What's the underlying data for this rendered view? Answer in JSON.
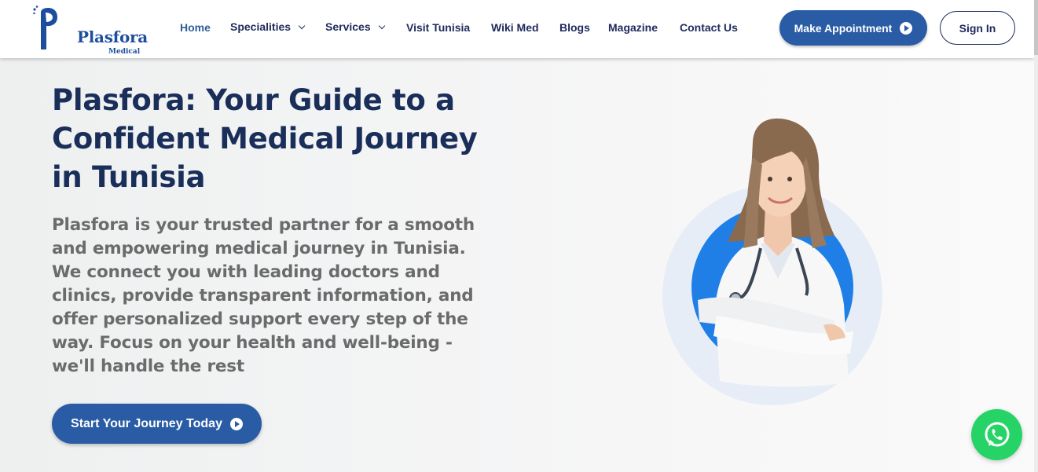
{
  "brand": {
    "name": "Plasfora",
    "sub": "Medical"
  },
  "nav": {
    "home": "Home",
    "specialities": "Specialities",
    "services": "Services",
    "visit": "Visit Tunisia",
    "wiki": "Wiki Med",
    "blogs": "Blogs",
    "magazine": "Magazine",
    "contact": "Contact Us"
  },
  "actions": {
    "appointment": "Make Appointment",
    "signin": "Sign In"
  },
  "hero": {
    "title": "Plasfora: Your Guide to a Confident Medical Journey in Tunisia",
    "description": "Plasfora is your trusted partner for a smooth and empowering medical journey in Tunisia. We connect you with leading doctors and clinics, provide transparent information, and offer personalized support every step of the way. Focus on your health and well-being - we'll handle the rest",
    "cta": "Start Your Journey Today"
  },
  "icons": {
    "logo": "plasfora-logo-icon",
    "play": "play-circle-icon",
    "chevron": "chevron-down-icon",
    "whatsapp": "whatsapp-icon"
  },
  "colors": {
    "primary": "#2a5ba5",
    "navy": "#1f2a5c",
    "heading": "#1a2e5a",
    "whatsapp": "#25d366"
  }
}
